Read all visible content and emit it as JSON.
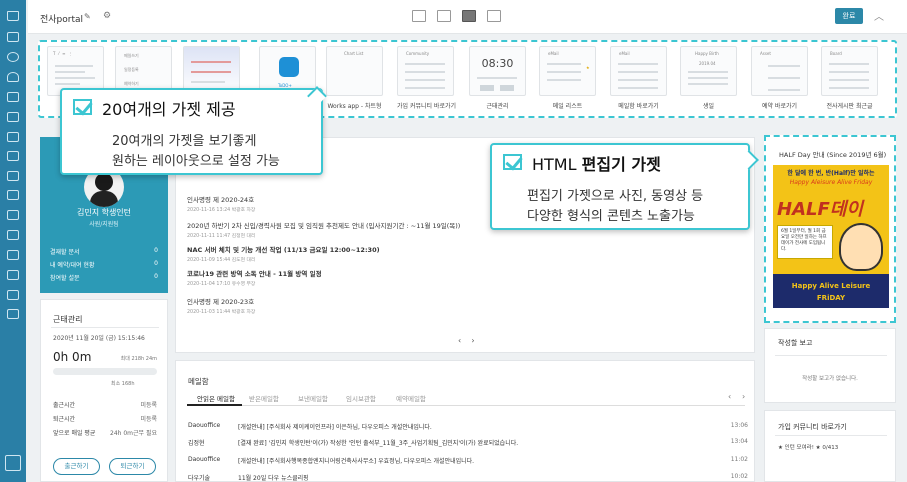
{
  "topbar": {
    "portal_title": "전사portal",
    "done_label": "완료"
  },
  "gadgets": [
    {
      "label": "",
      "thumb": "text-editor"
    },
    {
      "label": "",
      "thumb": "menu-list"
    },
    {
      "label": "",
      "thumb": "board-plate"
    },
    {
      "label": "",
      "thumb": "todo"
    },
    {
      "label": "Works app - 차트형",
      "thumb_title": "Chart List"
    },
    {
      "label": "가입 커뮤니티 바로가기",
      "thumb_title": "Community"
    },
    {
      "label": "근태관리",
      "thumb_title": "08:30"
    },
    {
      "label": "메일 리스트",
      "thumb_title": "eMail"
    },
    {
      "label": "메일함 바로가기",
      "thumb_title": "eMail"
    },
    {
      "label": "생일",
      "thumb_title": "Happy Birth"
    },
    {
      "label": "예약 바로가기",
      "thumb_title": "Asset"
    },
    {
      "label": "전사게시판 최근글",
      "thumb_title": "Board"
    }
  ],
  "menu_thumb_items": [
    "메일쓰기",
    "일정등록",
    "예약하기"
  ],
  "birthday_thumb_month": "2019.04",
  "callout_gadgets": {
    "title": "20여개의 가젯 제공",
    "line1": "20여개의 가젯을 보기좋게",
    "line2": "원하는 레이아웃으로 설정 가능"
  },
  "callout_editor": {
    "title_html": "HTML",
    "title_rest": "편집기 가젯",
    "line1": "편집기 가젯으로 사진, 동영상 등",
    "line2": "다양한 형식의 콘텐츠 노출가능"
  },
  "profile": {
    "name": "김민지 학생인턴",
    "role": "사원/지원팀",
    "stats": [
      {
        "label": "결재할 문서",
        "value": "0"
      },
      {
        "label": "내 예약/대여 현황",
        "value": "0"
      },
      {
        "label": "참여할 설문",
        "value": "0"
      }
    ]
  },
  "attendance": {
    "title": "근태관리",
    "date": "2020년 11월 20일 (금) 15:15:46",
    "elapsed": "0h 0m",
    "max": "최대 218h 24m",
    "progress_percent": 0,
    "min": "최소 168h",
    "rows": [
      {
        "label": "출근시간",
        "value": "미등록"
      },
      {
        "label": "퇴근시간",
        "value": "미등록"
      },
      {
        "label": "앞으로 매일 평균",
        "value": "24h 0m근무 필요"
      }
    ],
    "checkin": "출근하기",
    "checkout": "퇴근하기"
  },
  "notices": [
    {
      "title": "인사명령 제 2020-24호",
      "meta": "2020-11-16 13:24   박광호 차장",
      "bold": false
    },
    {
      "title": "2020년 하반기 2차 신입/경력사원 모집 및 임직원 추천제도 안내 (입사지원기간 : ~11월 19일(목))",
      "meta": "2020-11-11 11:47   김정현 대리",
      "bold": false
    },
    {
      "title": "NAC 서버 체치 및 기능 개선 작업 (11/13 금요일 12:00~12:30)",
      "meta": "2020-11-09 15:44   김도현 대리",
      "bold": true
    },
    {
      "title": "코로나19 관련 방역 소독 안내 - 11월 방역 일정",
      "meta": "2020-11-04 17:10   유수영 부장",
      "bold": true
    },
    {
      "title": "인사명령 제 2020-23호",
      "meta": "2020-11-03 11:44   박광호 차장",
      "bold": false
    }
  ],
  "mailbox": {
    "title": "메일함",
    "tabs": [
      "안읽은 메일함",
      "받은메일함",
      "보낸메일함",
      "임시보관함",
      "예약메일함"
    ],
    "rows": [
      {
        "from": "Daouoffice",
        "subject": "[개설안내] [주식회사 제이케이인프라] 이은하님, 다우오피스 개설안내입니다.",
        "time": "13:06"
      },
      {
        "from": "김정현",
        "subject": "[결재 완료] '김민지 학생인턴'이(가) 작성한 '인턴 출석부_11월_3주_사업기획팀_김민지'이(가) 완료되었습니다.",
        "time": "13:04"
      },
      {
        "from": "Daouoffice",
        "subject": "[개설안내] [주식회사행복종합엔지니어링건축사사무소] 우효정님, 다우오피스 개설안내입니다.",
        "time": "11:02"
      },
      {
        "from": "다우기술",
        "subject": "11월 20일 다우 뉴스클리핑",
        "time": "10:02"
      }
    ]
  },
  "editor_gadget": {
    "title": "HALF Day 안내 (Since 2019년 6월)",
    "banner_top": "한 달에 한 번, 반(Half)만 일하는",
    "banner_mid": "Happy Aleisure Alive Friday",
    "banner_logo": "HALF데이",
    "banner_desc": "6월 1일부터, 월 1회 금요일 오전만 일하는 하프데이가 전사에 도입됩니다.",
    "banner_foot1": "Happy Alive Leisure",
    "banner_foot2": "FRiDAY"
  },
  "report": {
    "title": "작성할 보고",
    "empty": "작성할 보고가 없습니다."
  },
  "community": {
    "title": "가입 커뮤니티 바로가기",
    "entry": "★ 인턴 모여라! ★ 0/413"
  },
  "colors": {
    "nav": "#2a7fa6",
    "accent": "#3cc6d2",
    "profile": "#2c9ab6",
    "button": "#2c88a8"
  }
}
